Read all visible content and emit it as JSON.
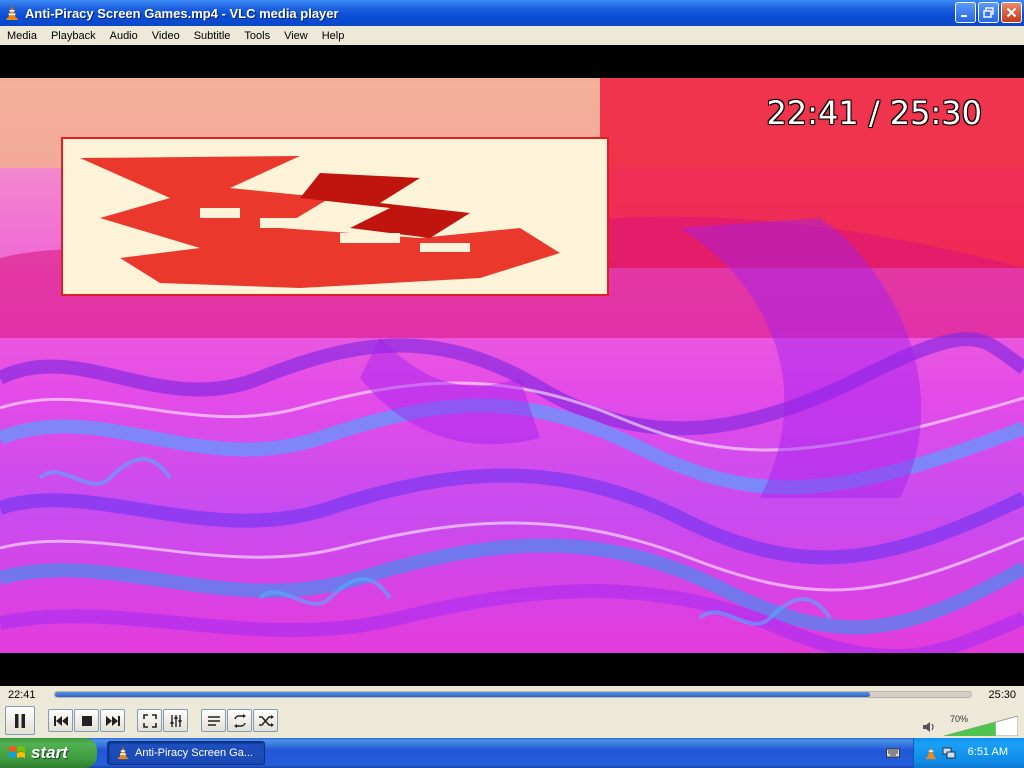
{
  "window": {
    "title": "Anti-Piracy Screen Games.mp4 - VLC media player",
    "controls": [
      "minimize",
      "restore",
      "close"
    ]
  },
  "menu": [
    "Media",
    "Playback",
    "Audio",
    "Video",
    "Subtitle",
    "Tools",
    "View",
    "Help"
  ],
  "video": {
    "osd_time": "22:41 / 25:30"
  },
  "seek": {
    "elapsed": "22:41",
    "total": "25:30",
    "progress_fraction": 0.89
  },
  "controls": {
    "buttons": [
      "pause",
      "previous",
      "stop",
      "next",
      "fullscreen",
      "extended-settings",
      "playlist",
      "loop",
      "random"
    ],
    "volume_label": "70%",
    "volume_fraction": 0.7
  },
  "taskbar": {
    "start_label": "start",
    "task_label": "Anti-Piracy Screen Ga...",
    "clock": "6:51 AM"
  },
  "colors": {
    "title_blue": "#0a4ed8",
    "start_green": "#3f9b3f",
    "seek_fill": "#3160c4",
    "vlc_orange": "#f08a16"
  },
  "icons": [
    "vlc-cone-icon",
    "minimize-icon",
    "restore-icon",
    "close-icon",
    "windows-flag-icon",
    "speaker-icon",
    "keyboard-icon",
    "network-icon"
  ]
}
